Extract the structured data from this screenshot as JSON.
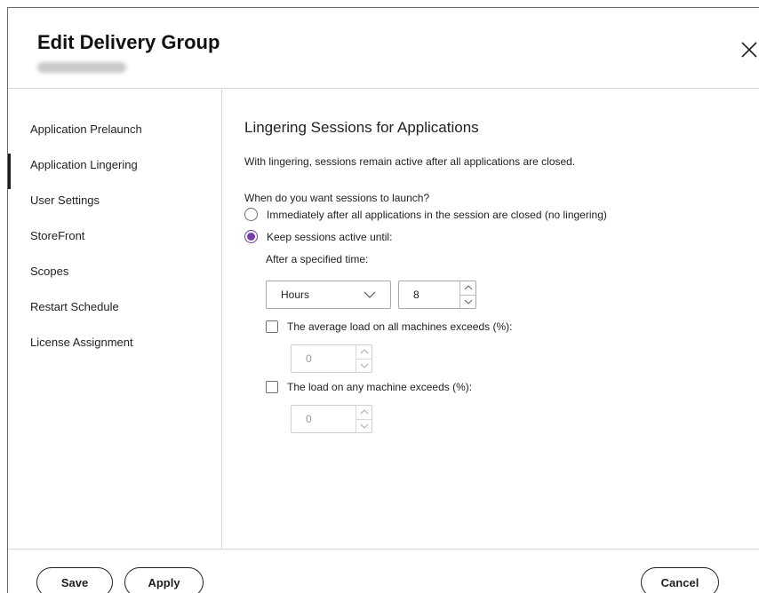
{
  "dialog": {
    "title": "Edit Delivery Group"
  },
  "sidebar": {
    "items": [
      {
        "label": "Application Prelaunch"
      },
      {
        "label": "Application Lingering"
      },
      {
        "label": "User Settings"
      },
      {
        "label": "StoreFront"
      },
      {
        "label": "Scopes"
      },
      {
        "label": "Restart Schedule"
      },
      {
        "label": "License Assignment"
      }
    ],
    "active_item": "Application Lingering"
  },
  "content": {
    "section_title": "Lingering Sessions for Applications",
    "description": "With lingering, sessions remain active after all applications are closed.",
    "question": "When do you want sessions to launch?",
    "option_immediate": "Immediately after all applications in the session are closed (no lingering)",
    "option_keep": "Keep sessions active until:",
    "selected_option": "Keep sessions active until:",
    "after_time_label": "After a specified time:",
    "time_unit": "Hours",
    "time_value": "8",
    "avg_load_label": "The average load on all machines exceeds (%):",
    "avg_load_checked": false,
    "avg_load_value": "0",
    "any_load_label": "The load on any machine exceeds (%):",
    "any_load_checked": false,
    "any_load_value": "0"
  },
  "footer": {
    "save_label": "Save",
    "apply_label": "Apply",
    "cancel_label": "Cancel"
  },
  "colors": {
    "accent_radio": "#7a3ea8",
    "border": "#a9a9a9"
  },
  "icons": {
    "close": "close-icon",
    "dropdown": "chevron-down-icon",
    "stepper_up": "chevron-up-icon",
    "stepper_down": "chevron-down-icon"
  }
}
